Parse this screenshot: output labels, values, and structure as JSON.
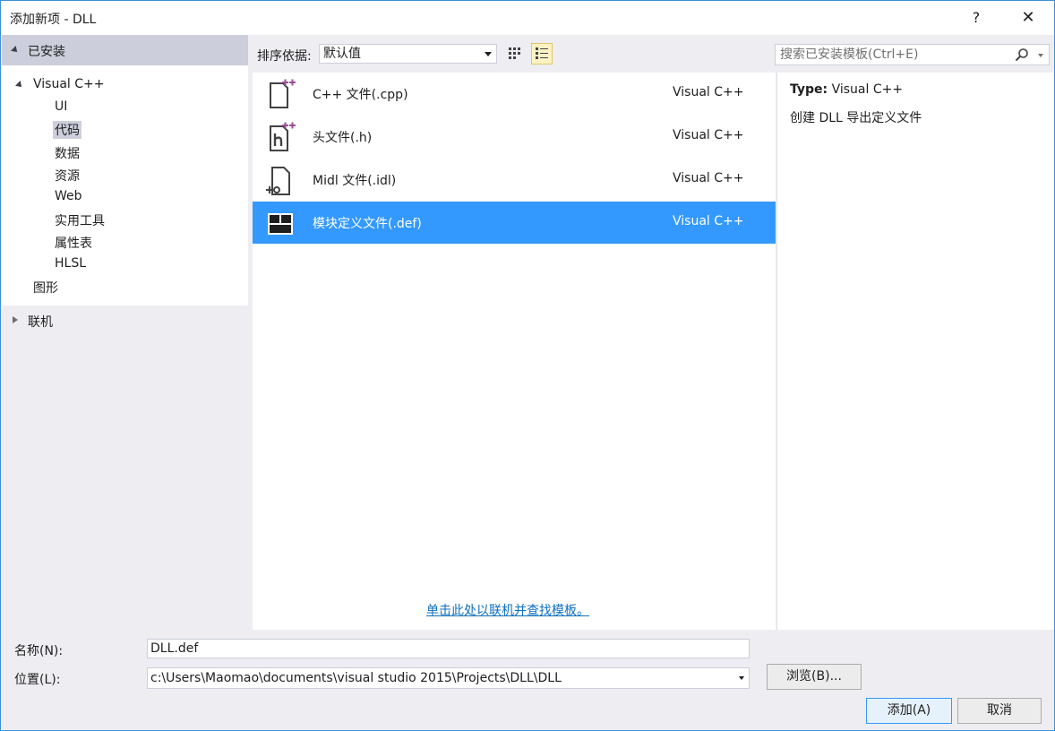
{
  "window": {
    "title": "添加新项 - DLL",
    "help_label": "?",
    "close_label": "✕"
  },
  "sidebar": {
    "installed_label": "已安装",
    "visual_cpp_label": "Visual C++",
    "children": [
      "UI",
      "代码",
      "数据",
      "资源",
      "Web",
      "实用工具",
      "属性表",
      "HLSL"
    ],
    "selected": "代码",
    "graphics_label": "图形",
    "online_label": "联机"
  },
  "toolbar": {
    "sort_label": "排序依据:",
    "sort_value": "默认值",
    "search_placeholder": "搜索已安装模板(Ctrl+E)"
  },
  "templates": [
    {
      "name": "C++ 文件(.cpp)",
      "lang": "Visual C++",
      "icon": "cpp-file-icon"
    },
    {
      "name": "头文件(.h)",
      "lang": "Visual C++",
      "icon": "header-file-icon"
    },
    {
      "name": "Midl 文件(.idl)",
      "lang": "Visual C++",
      "icon": "idl-file-icon"
    },
    {
      "name": "模块定义文件(.def)",
      "lang": "Visual C++",
      "icon": "def-file-icon",
      "selected": true
    }
  ],
  "online_link": "单击此处以联机并查找模板。",
  "description": {
    "type_label": "Type:",
    "type_value": "Visual C++",
    "text": "创建 DLL 导出定义文件"
  },
  "form": {
    "name_label": "名称(N):",
    "name_value": "DLL.def",
    "location_label": "位置(L):",
    "location_value": "c:\\Users\\Maomao\\documents\\visual studio 2015\\Projects\\DLL\\DLL",
    "browse_label": "浏览(B)...",
    "add_label": "添加(A)",
    "cancel_label": "取消"
  },
  "colors": {
    "accent": "#3399ff",
    "link": "#0e70c0",
    "selection_gray": "#cccedb",
    "icon_purple": "#9b4f96"
  }
}
